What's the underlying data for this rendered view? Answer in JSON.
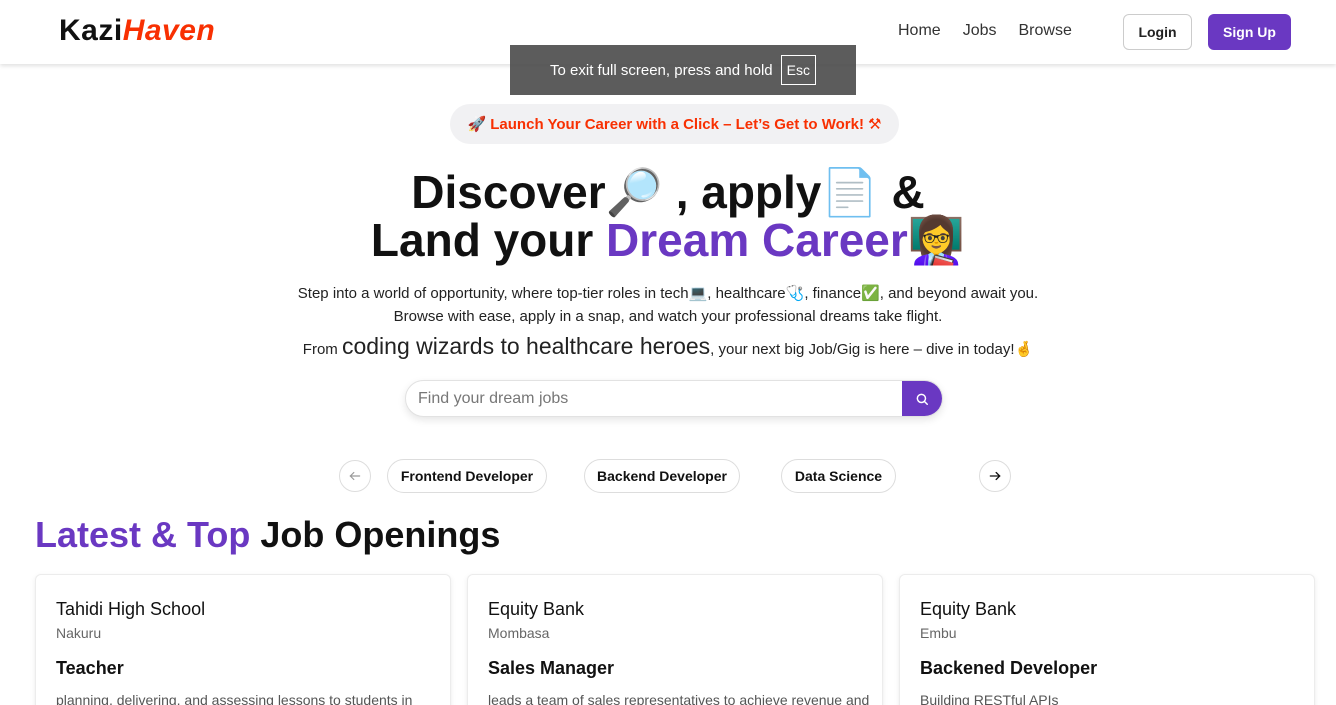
{
  "brand": {
    "part1": "Kazi",
    "part2": "Haven"
  },
  "nav": {
    "links": [
      "Home",
      "Jobs",
      "Browse"
    ],
    "login_label": "Login",
    "signup_label": "Sign Up"
  },
  "fullscreen_toast": {
    "text": "To exit full screen, press and hold",
    "key": "Esc"
  },
  "hero": {
    "tagline": "Launch Your Career with a Click – Let’s Get to Work!",
    "line1_part1": "Discover",
    "line1_part2": ", apply",
    "line1_part3": "&",
    "line2_part1": "Land your",
    "line2_accent": "Dream Career",
    "desc1_a": "Step into a world of opportunity, where top-tier roles in tech",
    "desc1_b": ", healthcare",
    "desc1_c": ", finance",
    "desc1_d": ", and beyond await you.",
    "desc2": "Browse with ease, apply in a snap, and watch your professional dreams take flight.",
    "desc3_prefix": "From",
    "desc3_big": "coding wizards to healthcare heroes",
    "desc3_suffix": ", your next big Job/Gig is here – dive in today!"
  },
  "search": {
    "placeholder": "Find your dream jobs",
    "value": ""
  },
  "categories": [
    "Frontend Developer",
    "Backend Developer",
    "Data Science"
  ],
  "section": {
    "title_accent": "Latest & Top",
    "title_rest": "Job Openings"
  },
  "jobs": [
    {
      "company": "Tahidi High School",
      "location": "Nakuru",
      "title": "Teacher",
      "description": "planning, delivering, and assessing lessons to students in"
    },
    {
      "company": "Equity Bank",
      "location": "Mombasa",
      "title": "Sales Manager",
      "description": "leads a team of sales representatives to achieve revenue and"
    },
    {
      "company": "Equity Bank",
      "location": "Embu",
      "title": "Backened Developer",
      "description": "Building RESTful APIs"
    }
  ],
  "colors": {
    "primary": "#6a38c2",
    "brand_accent": "#f83002"
  },
  "icons": [
    "search-icon",
    "arrow-left-icon",
    "arrow-right-icon",
    "rocket-icon",
    "tools-icon",
    "magnifier-icon",
    "document-icon",
    "teacher-icon",
    "laptop-icon",
    "stethoscope-icon",
    "check-icon",
    "crossed-fingers-icon"
  ]
}
